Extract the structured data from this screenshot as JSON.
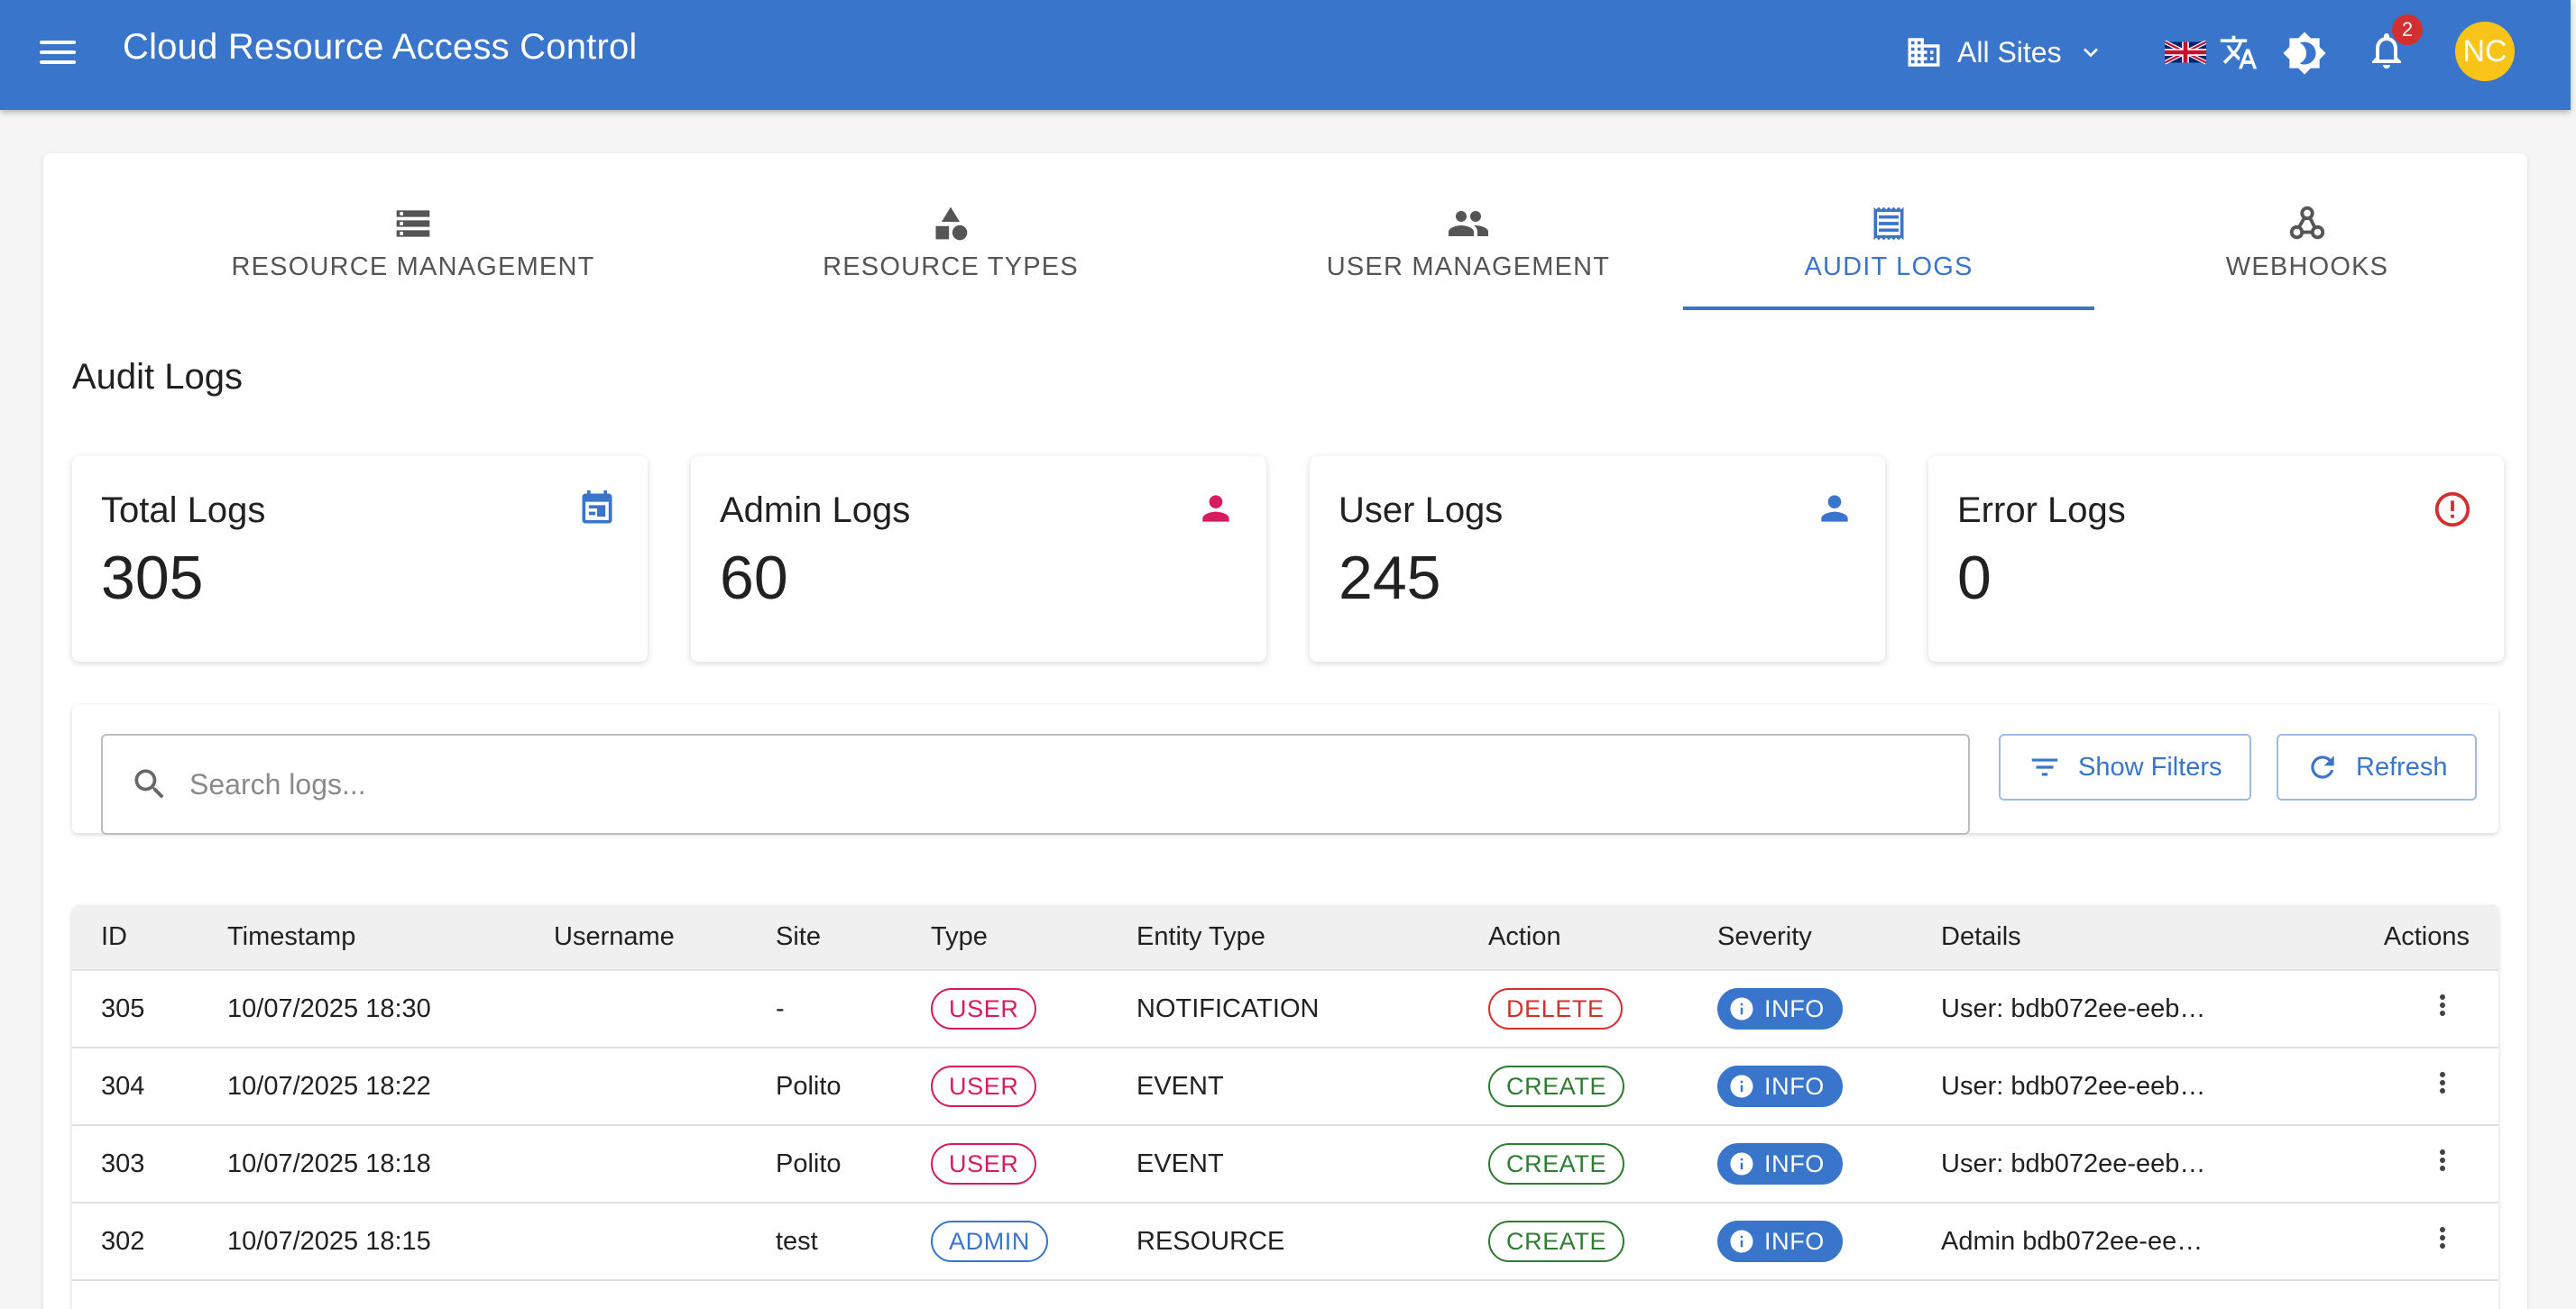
{
  "appbar": {
    "title": "Cloud Resource Access Control",
    "site_selector": "All Sites",
    "notifications_count": "2",
    "avatar_initials": "NC",
    "color": "#3a75cc"
  },
  "tabs": [
    {
      "label": "RESOURCE MANAGEMENT",
      "icon": "storage-icon",
      "active": false
    },
    {
      "label": "RESOURCE TYPES",
      "icon": "category-icon",
      "active": false
    },
    {
      "label": "USER MANAGEMENT",
      "icon": "people-icon",
      "active": false
    },
    {
      "label": "AUDIT LOGS",
      "icon": "receipt-icon",
      "active": true
    },
    {
      "label": "WEBHOOKS",
      "icon": "webhook-icon",
      "active": false
    }
  ],
  "page": {
    "title": "Audit Logs"
  },
  "stats": [
    {
      "label": "Total Logs",
      "value": "305",
      "icon": "calendar-icon",
      "color": "#3a75cc"
    },
    {
      "label": "Admin Logs",
      "value": "60",
      "icon": "person-icon",
      "color": "#d81b60"
    },
    {
      "label": "User Logs",
      "value": "245",
      "icon": "person-icon",
      "color": "#3a75cc"
    },
    {
      "label": "Error Logs",
      "value": "0",
      "icon": "error-icon",
      "color": "#d32f2f"
    }
  ],
  "search": {
    "placeholder": "Search logs...",
    "show_filters_label": "Show Filters",
    "refresh_label": "Refresh"
  },
  "table": {
    "columns": [
      "ID",
      "Timestamp",
      "Username",
      "Site",
      "Type",
      "Entity Type",
      "Action",
      "Severity",
      "Details",
      "Actions"
    ],
    "rows": [
      {
        "id": "305",
        "timestamp": "10/07/2025 18:30",
        "username": "",
        "site": "-",
        "type": "USER",
        "entity_type": "NOTIFICATION",
        "action": "DELETE",
        "severity": "INFO",
        "details": "User: bdb072ee-eeb…"
      },
      {
        "id": "304",
        "timestamp": "10/07/2025 18:22",
        "username": "",
        "site": "Polito",
        "type": "USER",
        "entity_type": "EVENT",
        "action": "CREATE",
        "severity": "INFO",
        "details": "User: bdb072ee-eeb…"
      },
      {
        "id": "303",
        "timestamp": "10/07/2025 18:18",
        "username": "",
        "site": "Polito",
        "type": "USER",
        "entity_type": "EVENT",
        "action": "CREATE",
        "severity": "INFO",
        "details": "User: bdb072ee-eeb…"
      },
      {
        "id": "302",
        "timestamp": "10/07/2025 18:15",
        "username": "",
        "site": "test",
        "type": "ADMIN",
        "entity_type": "RESOURCE",
        "action": "CREATE",
        "severity": "INFO",
        "details": "Admin bdb072ee-ee…"
      }
    ]
  }
}
